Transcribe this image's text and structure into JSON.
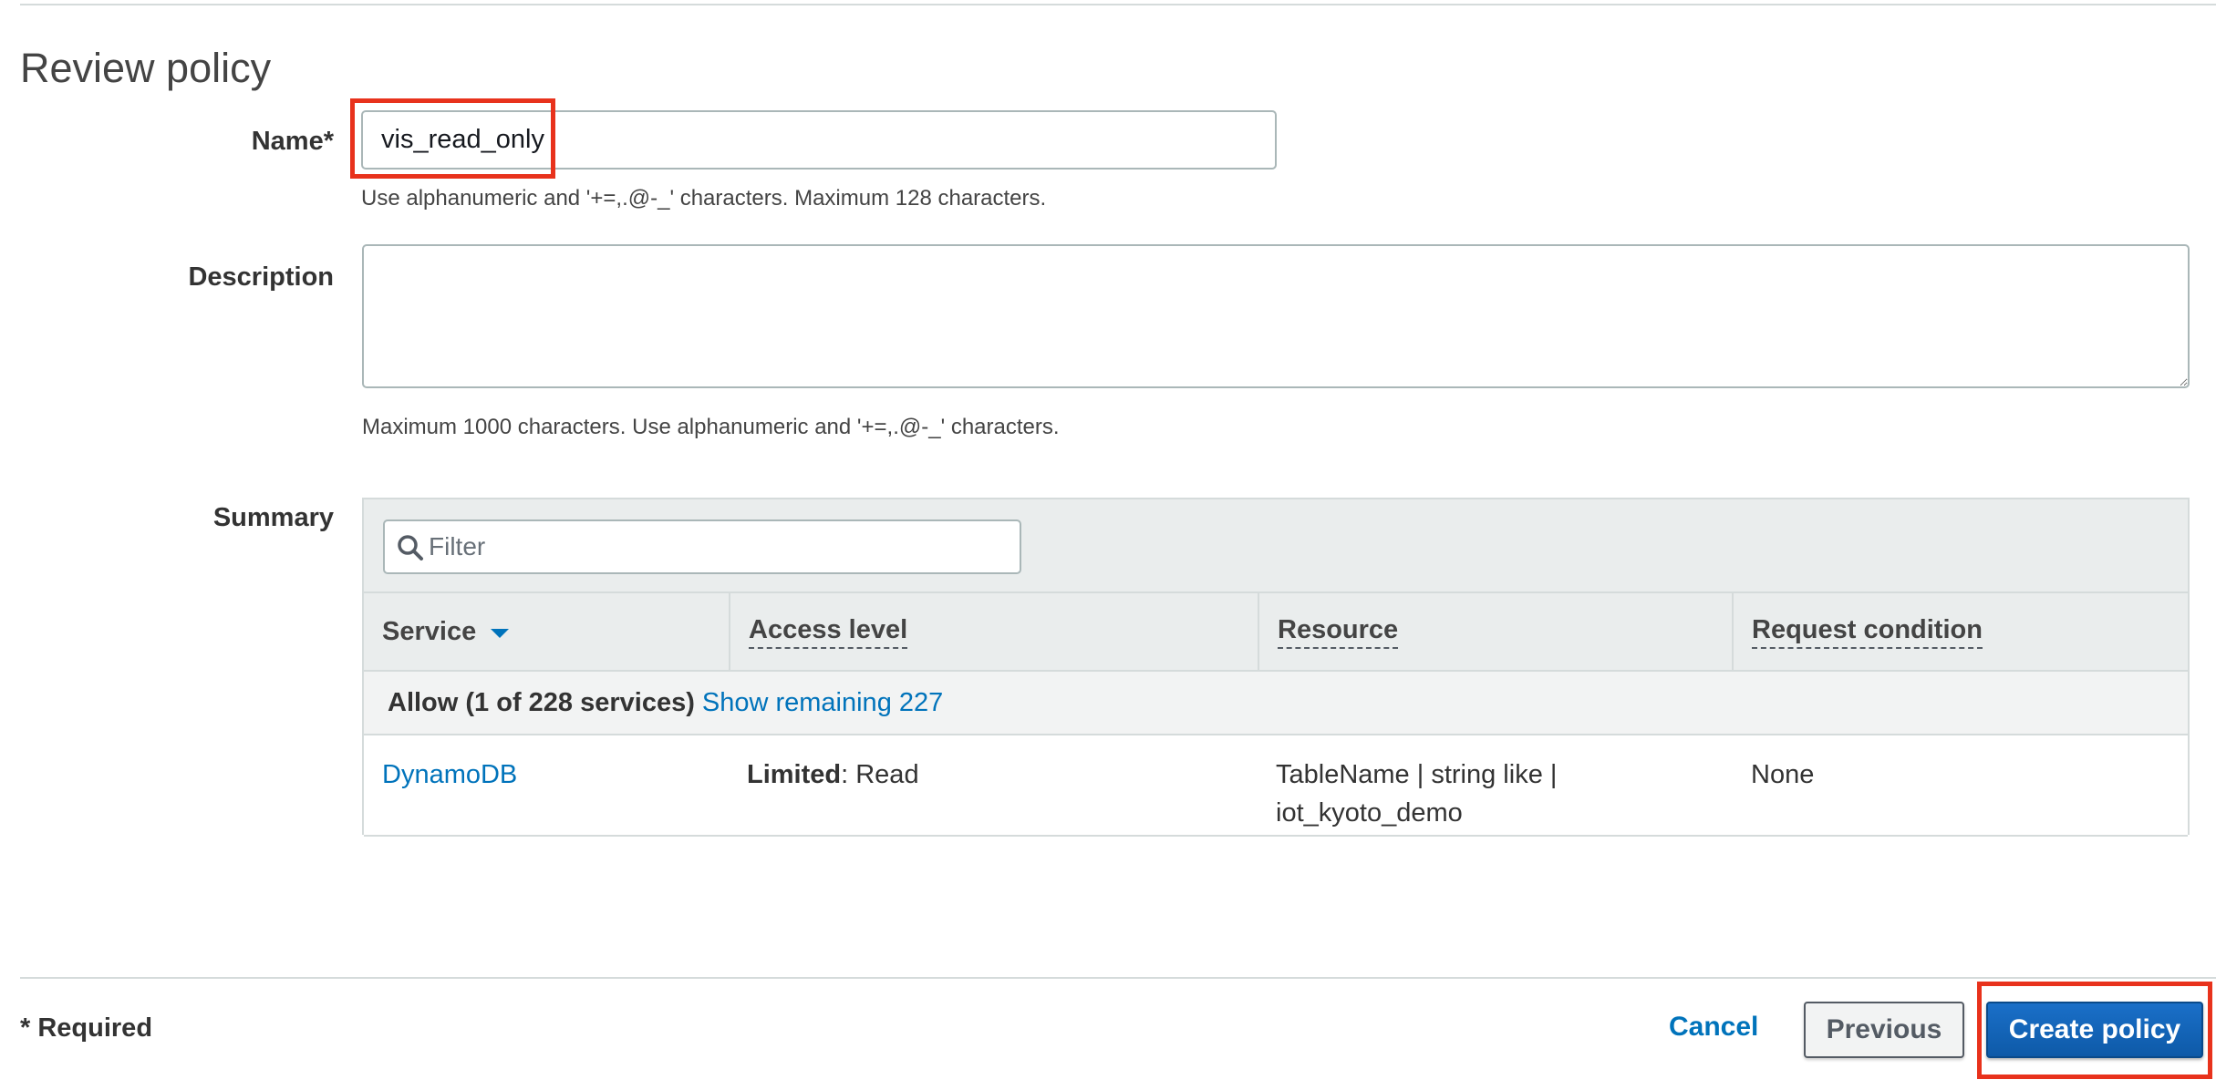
{
  "page": {
    "title": "Review policy"
  },
  "form": {
    "name_label": "Name*",
    "name_value": "vis_read_only",
    "name_hint": "Use alphanumeric and '+=,.@-_' characters. Maximum 128 characters.",
    "description_label": "Description",
    "description_value": "",
    "description_hint": "Maximum 1000 characters. Use alphanumeric and '+=,.@-_' characters.",
    "summary_label": "Summary"
  },
  "summary": {
    "filter_placeholder": "Filter",
    "columns": [
      "Service",
      "Access level",
      "Resource",
      "Request condition"
    ],
    "group": {
      "title": "Allow (1 of 228 services)",
      "link": "Show remaining 227"
    },
    "rows": [
      {
        "service": "DynamoDB",
        "access_level_bold": "Limited",
        "access_level_rest": ": Read",
        "resource_line1": "TableName | string like |",
        "resource_line2": "iot_kyoto_demo",
        "request_condition": "None"
      }
    ]
  },
  "footer": {
    "required_note": "* Required",
    "cancel_label": "Cancel",
    "previous_label": "Previous",
    "create_label": "Create policy"
  },
  "colors": {
    "link": "#0073bb",
    "primary_button": "#0e5aa8",
    "highlight": "#e8321c"
  },
  "icons": {
    "filter": "search-icon",
    "sort": "caret-down-icon"
  }
}
